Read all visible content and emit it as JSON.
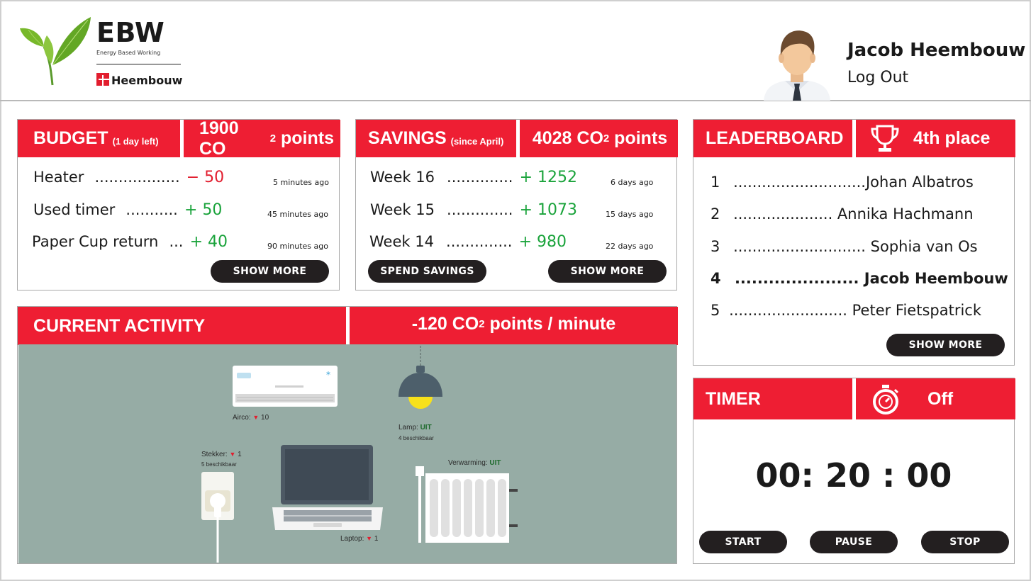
{
  "brand": {
    "name": "EBW",
    "subtitle": "Energy Based Working",
    "company": "Heembouw"
  },
  "user": {
    "name": "Jacob Heembouw",
    "logout_label": "Log Out"
  },
  "budget": {
    "title": "BUDGET",
    "subtitle": "(1 day left)",
    "points_prefix": "1900 CO",
    "points_sub": "2",
    "points_suffix": " points",
    "items": [
      {
        "label": "Heater",
        "dots": "..................",
        "value": "− 50",
        "ago": "5 minutes ago",
        "color": "#e21d2e"
      },
      {
        "label": "Used timer",
        "dots": "...........",
        "value": "+ 50",
        "ago": "45 minutes ago",
        "color": "#1aa33b"
      },
      {
        "label": "Paper Cup return",
        "dots": "...",
        "value": "+ 40",
        "ago": "90 minutes ago",
        "color": "#1aa33b"
      }
    ],
    "show_more": "SHOW MORE"
  },
  "savings": {
    "title": "SAVINGS",
    "subtitle": "(since April)",
    "points_prefix": "4028 CO",
    "points_sub": "2",
    "points_suffix": " points",
    "items": [
      {
        "label": "Week 16",
        "dots": "..............",
        "value": "+ 1252",
        "ago": "6 days ago"
      },
      {
        "label": "Week 15",
        "dots": "..............",
        "value": "+ 1073",
        "ago": "15 days ago"
      },
      {
        "label": "Week 14",
        "dots": "..............",
        "value": "+ 980",
        "ago": "22 days ago"
      }
    ],
    "spend_label": "SPEND SAVINGS",
    "show_more": "SHOW MORE"
  },
  "leaderboard": {
    "title": "LEADERBOARD",
    "place": "4th place",
    "entries": [
      {
        "rank": "1",
        "dots": "............................",
        "name": "Johan Albatros"
      },
      {
        "rank": "2",
        "dots": "..................... ",
        "name": "Annika Hachmann"
      },
      {
        "rank": "3",
        "dots": "............................ ",
        "name": "Sophia van Os"
      },
      {
        "rank": "4",
        "dots": "...................... ",
        "name": "Jacob Heembouw"
      },
      {
        "rank": "5",
        "dots": "......................... ",
        "name": "Peter Fietspatrick"
      }
    ],
    "show_more": "SHOW MORE"
  },
  "activity": {
    "title": "CURRENT ACTIVITY",
    "rate_prefix": "-120 CO",
    "rate_sub": "2",
    "rate_suffix": " points / minute",
    "devices": {
      "airco": {
        "label": "Airco:",
        "value": "10"
      },
      "lamp": {
        "label": "Lamp:",
        "status": "UIT",
        "available": "4 beschikbaar"
      },
      "stekker": {
        "label": "Stekker:",
        "value": "1",
        "available": "5 beschikbaar"
      },
      "laptop": {
        "label": "Laptop:",
        "value": "1"
      },
      "verwarming": {
        "label": "Verwarming:",
        "status": "UIT"
      }
    }
  },
  "timer": {
    "title": "TIMER",
    "status": "Off",
    "display": "00: 20 : 00",
    "start": "START",
    "pause": "PAUSE",
    "stop": "STOP"
  },
  "colors": {
    "accent": "#ee1e33",
    "positive": "#1aa33b",
    "negative": "#e21d2e",
    "button": "#231f20",
    "activity_bg": "#96aca5"
  }
}
